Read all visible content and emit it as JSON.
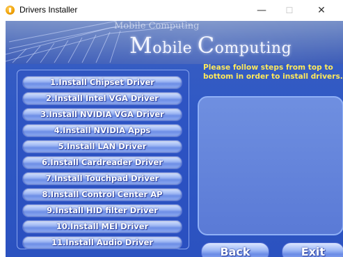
{
  "window": {
    "title": "Drivers Installer",
    "controls": {
      "minimize": "—",
      "maximize": "☐",
      "close": "✕"
    }
  },
  "banner": {
    "small_text": "Mobile Computing",
    "brand_first_cap": "M",
    "brand_first_rest": "obile ",
    "brand_second_cap": "C",
    "brand_second_rest": "omputing"
  },
  "install_buttons": [
    {
      "label": "1.Install Chipset Driver"
    },
    {
      "label": "2.Install Intel VGA Driver"
    },
    {
      "label": "3.Install NVIDIA VGA Driver"
    },
    {
      "label": "4.Install NVIDIA Apps"
    },
    {
      "label": "5.Install LAN Driver"
    },
    {
      "label": "6.Install Cardreader Driver"
    },
    {
      "label": "7.Install Touchpad Driver"
    },
    {
      "label": "8.Install Control Center AP"
    },
    {
      "label": "9.Install HID filter Driver"
    },
    {
      "label": "10.Install MEI Driver"
    },
    {
      "label": "11.Install Audio Driver"
    }
  ],
  "instructions": "Please follow steps from top to bottom in order to install drivers.",
  "footer": {
    "back_label": "Back",
    "exit_label": "Exit"
  },
  "colors": {
    "background": "#2f58c4",
    "instruction_text": "#ffe95a",
    "button_text": "#ffffff"
  }
}
